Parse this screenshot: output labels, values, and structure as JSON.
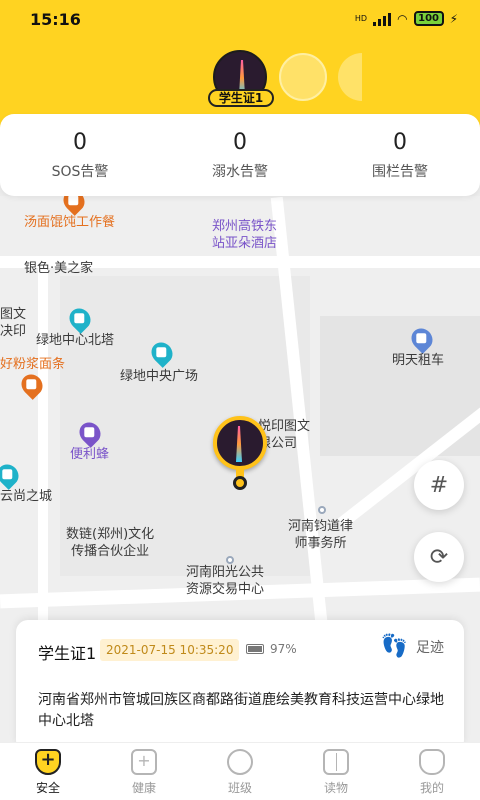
{
  "status_bar": {
    "time": "15:16",
    "battery": "100"
  },
  "header": {
    "student_name_pill": "学生证1"
  },
  "counters": [
    {
      "value": "0",
      "label": "SOS告警"
    },
    {
      "value": "0",
      "label": "溺水告警"
    },
    {
      "value": "0",
      "label": "围栏告警"
    }
  ],
  "map": {
    "pois": [
      {
        "text": "汤面馄饨工作餐",
        "style": "orange"
      },
      {
        "text": "郑州高铁东\n站亚朵酒店",
        "style": "purple"
      },
      {
        "text": "银色·美之家",
        "style": "normal"
      },
      {
        "text": "图文\n决印",
        "style": "normal"
      },
      {
        "text": "绿地中心北塔",
        "style": "normal"
      },
      {
        "text": "好粉浆面条",
        "style": "orange"
      },
      {
        "text": "绿地中央广场",
        "style": "normal"
      },
      {
        "text": "明天租车",
        "style": "normal"
      },
      {
        "text": "悦印图文\n限公司",
        "style": "normal"
      },
      {
        "text": "便利蜂",
        "style": "purple"
      },
      {
        "text": "云尚之城",
        "style": "normal"
      },
      {
        "text": "河南钧道律\n师事务所",
        "style": "normal"
      },
      {
        "text": "数链(郑州)文化\n传播合伙企业",
        "style": "normal"
      },
      {
        "text": "河南阳光公共\n资源交易中心",
        "style": "normal"
      }
    ],
    "grid_button_icon": "grid-icon",
    "refresh_button_icon": "refresh-icon"
  },
  "info_card": {
    "name": "学生证1",
    "timestamp": "2021-07-15 10:35:20",
    "battery": "97%",
    "trail_label": "足迹",
    "address": "河南省郑州市管城回族区商都路街道鹿绘美教育科技运营中心绿地中心北塔"
  },
  "tabs": [
    {
      "label": "安全",
      "icon": "shield-icon",
      "active": true
    },
    {
      "label": "健康",
      "icon": "medical-kit-icon",
      "active": false
    },
    {
      "label": "班级",
      "icon": "class-icon",
      "active": false
    },
    {
      "label": "读物",
      "icon": "book-icon",
      "active": false
    },
    {
      "label": "我的",
      "icon": "profile-icon",
      "active": false
    }
  ],
  "colors": {
    "brand_yellow": "#ffd321",
    "timestamp_text": "#c08a1a",
    "poi_orange": "#e4701f",
    "poi_purple": "#7a54c9"
  }
}
